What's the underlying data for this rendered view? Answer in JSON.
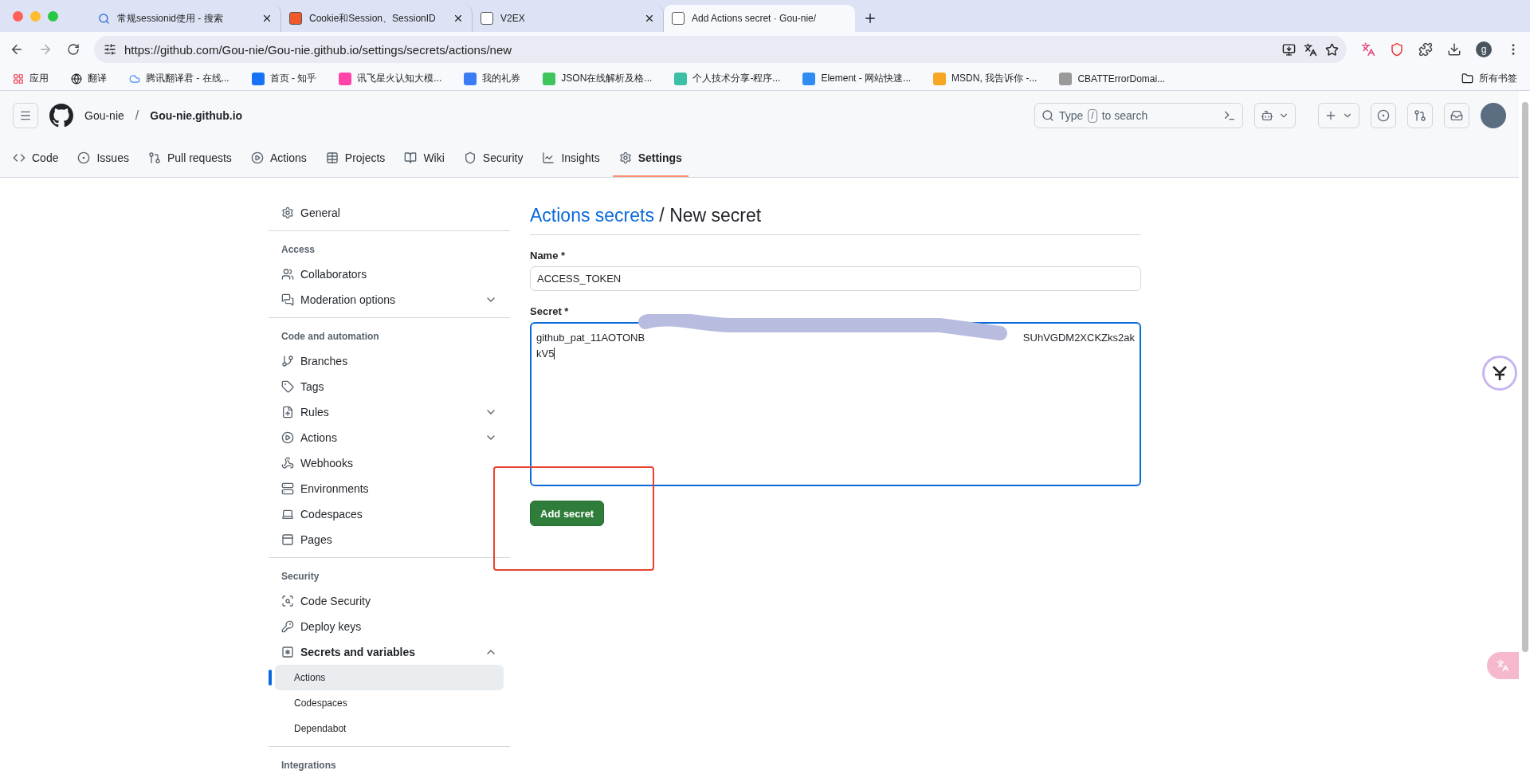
{
  "browser": {
    "tabs": [
      {
        "title": "常规sessionid使用 - 搜索",
        "selected": false
      },
      {
        "title": "Cookie和Session、SessionID",
        "selected": false
      },
      {
        "title": "V2EX",
        "selected": false
      },
      {
        "title": "Add Actions secret · Gou-nie/",
        "selected": true
      }
    ],
    "url": "https://github.com/Gou-nie/Gou-nie.github.io/settings/secrets/actions/new",
    "profile_initial": "g",
    "bookmarks": [
      "应用",
      "翻译",
      "腾讯翻译君 - 在线...",
      "首页 - 知乎",
      "讯飞星火认知大模...",
      "我的礼券",
      "JSON在线解析及格...",
      "个人技术分享-程序...",
      "Element - 网站快速...",
      "MSDN, 我告诉你 -...",
      "CBATTErrorDomai..."
    ],
    "all_bookmarks": "所有书签"
  },
  "repo": {
    "owner": "Gou-nie",
    "separator": "/",
    "name": "Gou-nie.github.io",
    "search": {
      "placeholder_before": "Type",
      "key": "/",
      "placeholder_after": "to search"
    },
    "nav": [
      {
        "label": "Code",
        "selected": false
      },
      {
        "label": "Issues",
        "selected": false
      },
      {
        "label": "Pull requests",
        "selected": false
      },
      {
        "label": "Actions",
        "selected": false
      },
      {
        "label": "Projects",
        "selected": false
      },
      {
        "label": "Wiki",
        "selected": false
      },
      {
        "label": "Security",
        "selected": false
      },
      {
        "label": "Insights",
        "selected": false
      },
      {
        "label": "Settings",
        "selected": true
      }
    ]
  },
  "sidebar": {
    "sections": [
      {
        "items": [
          {
            "label": "General",
            "selected": false
          }
        ]
      },
      {
        "heading": "Access",
        "items": [
          {
            "label": "Collaborators",
            "selected": false
          },
          {
            "label": "Moderation options",
            "selected": false,
            "expanded": false
          }
        ]
      },
      {
        "heading": "Code and automation",
        "items": [
          {
            "label": "Branches",
            "selected": false
          },
          {
            "label": "Tags",
            "selected": false
          },
          {
            "label": "Rules",
            "selected": false,
            "expanded": false
          },
          {
            "label": "Actions",
            "selected": false,
            "expanded": false
          },
          {
            "label": "Webhooks",
            "selected": false
          },
          {
            "label": "Environments",
            "selected": false
          },
          {
            "label": "Codespaces",
            "selected": false
          },
          {
            "label": "Pages",
            "selected": false
          }
        ]
      },
      {
        "heading": "Security",
        "items": [
          {
            "label": "Code Security",
            "selected": false
          },
          {
            "label": "Deploy keys",
            "selected": false
          },
          {
            "label": "Secrets and variables",
            "selected": false,
            "expanded": true,
            "children": [
              {
                "label": "Actions",
                "selected": true
              },
              {
                "label": "Codespaces",
                "selected": false
              },
              {
                "label": "Dependabot",
                "selected": false
              }
            ]
          }
        ]
      },
      {
        "heading": "Integrations"
      }
    ]
  },
  "form": {
    "breadcrumb_link": "Actions secrets",
    "breadcrumb_separator": "/",
    "title": "New secret",
    "name_label": "Name *",
    "name_value": "ACCESS_TOKEN",
    "secret_label": "Secret *",
    "secret_visible_start": "github_pat_11AOTONB",
    "secret_visible_end": "SUhVGDM2XCKZks2ak",
    "secret_line_2": "kV5",
    "submit": "Add secret"
  }
}
